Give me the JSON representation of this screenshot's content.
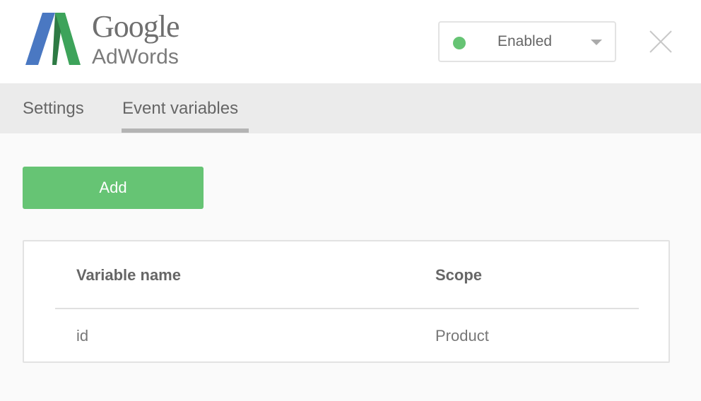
{
  "header": {
    "logo_brand": "Google",
    "logo_product": "AdWords",
    "status": {
      "label": "Enabled",
      "color": "#66c474",
      "icon": "chevron-down-icon"
    },
    "close_icon": "close-icon"
  },
  "tabs": [
    {
      "label": "Settings",
      "active": false
    },
    {
      "label": "Event variables",
      "active": true
    }
  ],
  "main": {
    "add_label": "Add",
    "accent_color": "#66c474",
    "table": {
      "columns": [
        "Variable name",
        "Scope"
      ],
      "rows": [
        {
          "name": "id",
          "scope": "Product"
        }
      ]
    }
  }
}
